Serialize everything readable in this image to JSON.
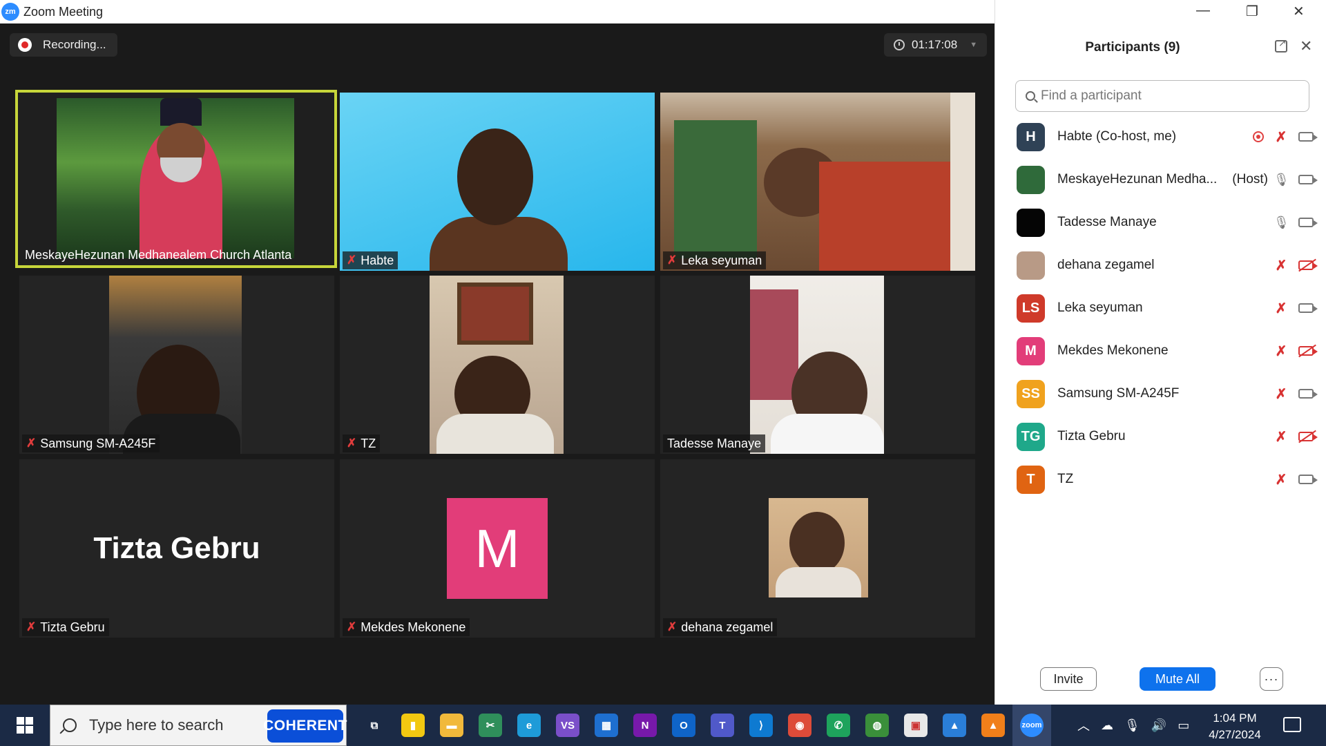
{
  "window": {
    "title": "Zoom Meeting",
    "logo": "zm",
    "minimize": "—",
    "restore": "❐",
    "close": "✕"
  },
  "recording": {
    "label": "Recording..."
  },
  "timer": {
    "value": "01:17:08"
  },
  "tiles": [
    {
      "name": "MeskayeHezunan Medhanealem Church Atlanta",
      "muted": false,
      "active": true
    },
    {
      "name": "Habte",
      "muted": true
    },
    {
      "name": "Leka seyuman",
      "muted": true
    },
    {
      "name": "Samsung SM-A245F",
      "muted": true
    },
    {
      "name": "TZ",
      "muted": true
    },
    {
      "name": "Tadesse Manaye",
      "muted": false
    },
    {
      "name": "Tizta Gebru",
      "muted": true,
      "big_label": "Tizta Gebru"
    },
    {
      "name": "Mekdes Mekonene",
      "muted": true,
      "avatar_letter": "M"
    },
    {
      "name": "dehana zegamel",
      "muted": true
    }
  ],
  "panel": {
    "title": "Participants (9)",
    "search_placeholder": "Find a participant",
    "participants": [
      {
        "initials": "H",
        "name": "Habte (Co-host, me)",
        "tag": "",
        "color": "#2f4256",
        "mic": "off",
        "cam": "on",
        "rec": true
      },
      {
        "initials": "",
        "name": "MeskayeHezunan Medha...",
        "tag": "(Host)",
        "color": "#2f6a3a",
        "mic": "on",
        "cam": "on"
      },
      {
        "initials": "",
        "name": "Tadesse Manaye",
        "tag": "",
        "color": "#050505",
        "mic": "on",
        "cam": "on"
      },
      {
        "initials": "",
        "name": "dehana zegamel",
        "tag": "",
        "color": "#b89a86",
        "mic": "off",
        "cam": "off"
      },
      {
        "initials": "LS",
        "name": "Leka seyuman",
        "tag": "",
        "color": "#cf3a2a",
        "mic": "off",
        "cam": "on"
      },
      {
        "initials": "M",
        "name": "Mekdes Mekonene",
        "tag": "",
        "color": "#e23d79",
        "mic": "off",
        "cam": "off"
      },
      {
        "initials": "SS",
        "name": "Samsung SM-A245F",
        "tag": "",
        "color": "#f0a21e",
        "mic": "off",
        "cam": "on"
      },
      {
        "initials": "TG",
        "name": "Tizta Gebru",
        "tag": "",
        "color": "#1fa88a",
        "mic": "off",
        "cam": "off"
      },
      {
        "initials": "T",
        "name": "TZ",
        "tag": "",
        "color": "#e06412",
        "mic": "off",
        "cam": "on"
      }
    ],
    "invite": "Invite",
    "mute_all": "Mute All",
    "more": "···"
  },
  "taskbar": {
    "search_placeholder": "Type here to search",
    "search_badge": "COHERENT",
    "apps": [
      {
        "name": "task-view-icon",
        "label": "⧉",
        "color": "transparent"
      },
      {
        "name": "power-bi-icon",
        "label": "▮",
        "color": "#f2c811"
      },
      {
        "name": "file-explorer-icon",
        "label": "▬",
        "color": "#f1b93b"
      },
      {
        "name": "snipping-tool-icon",
        "label": "✂",
        "color": "#2f8f5b"
      },
      {
        "name": "edge-icon",
        "label": "e",
        "color": "#1e9bd8"
      },
      {
        "name": "visual-studio-icon",
        "label": "VS",
        "color": "#7a4fc9"
      },
      {
        "name": "calculator-icon",
        "label": "▦",
        "color": "#1e6fd0"
      },
      {
        "name": "onenote-icon",
        "label": "N",
        "color": "#7719aa"
      },
      {
        "name": "outlook-icon",
        "label": "O",
        "color": "#0f64c8"
      },
      {
        "name": "teams-icon",
        "label": "T",
        "color": "#5059c9"
      },
      {
        "name": "vscode-icon",
        "label": "⟩",
        "color": "#0e7ad1"
      },
      {
        "name": "chrome-icon",
        "label": "◉",
        "color": "#dd4b39"
      },
      {
        "name": "whatsapp-icon",
        "label": "✆",
        "color": "#1ea35c"
      },
      {
        "name": "globe-icon",
        "label": "◍",
        "color": "#3a8f3a"
      },
      {
        "name": "store-icon",
        "label": "▣",
        "color": "#e8e8e8"
      },
      {
        "name": "photos-icon",
        "label": "▲",
        "color": "#2a7ed8"
      },
      {
        "name": "vlc-icon",
        "label": "▲",
        "color": "#f07f1a"
      },
      {
        "name": "zoom-icon",
        "label": "zoom",
        "color": "#2d8cff"
      }
    ],
    "time": "1:04 PM",
    "date": "4/27/2024"
  }
}
